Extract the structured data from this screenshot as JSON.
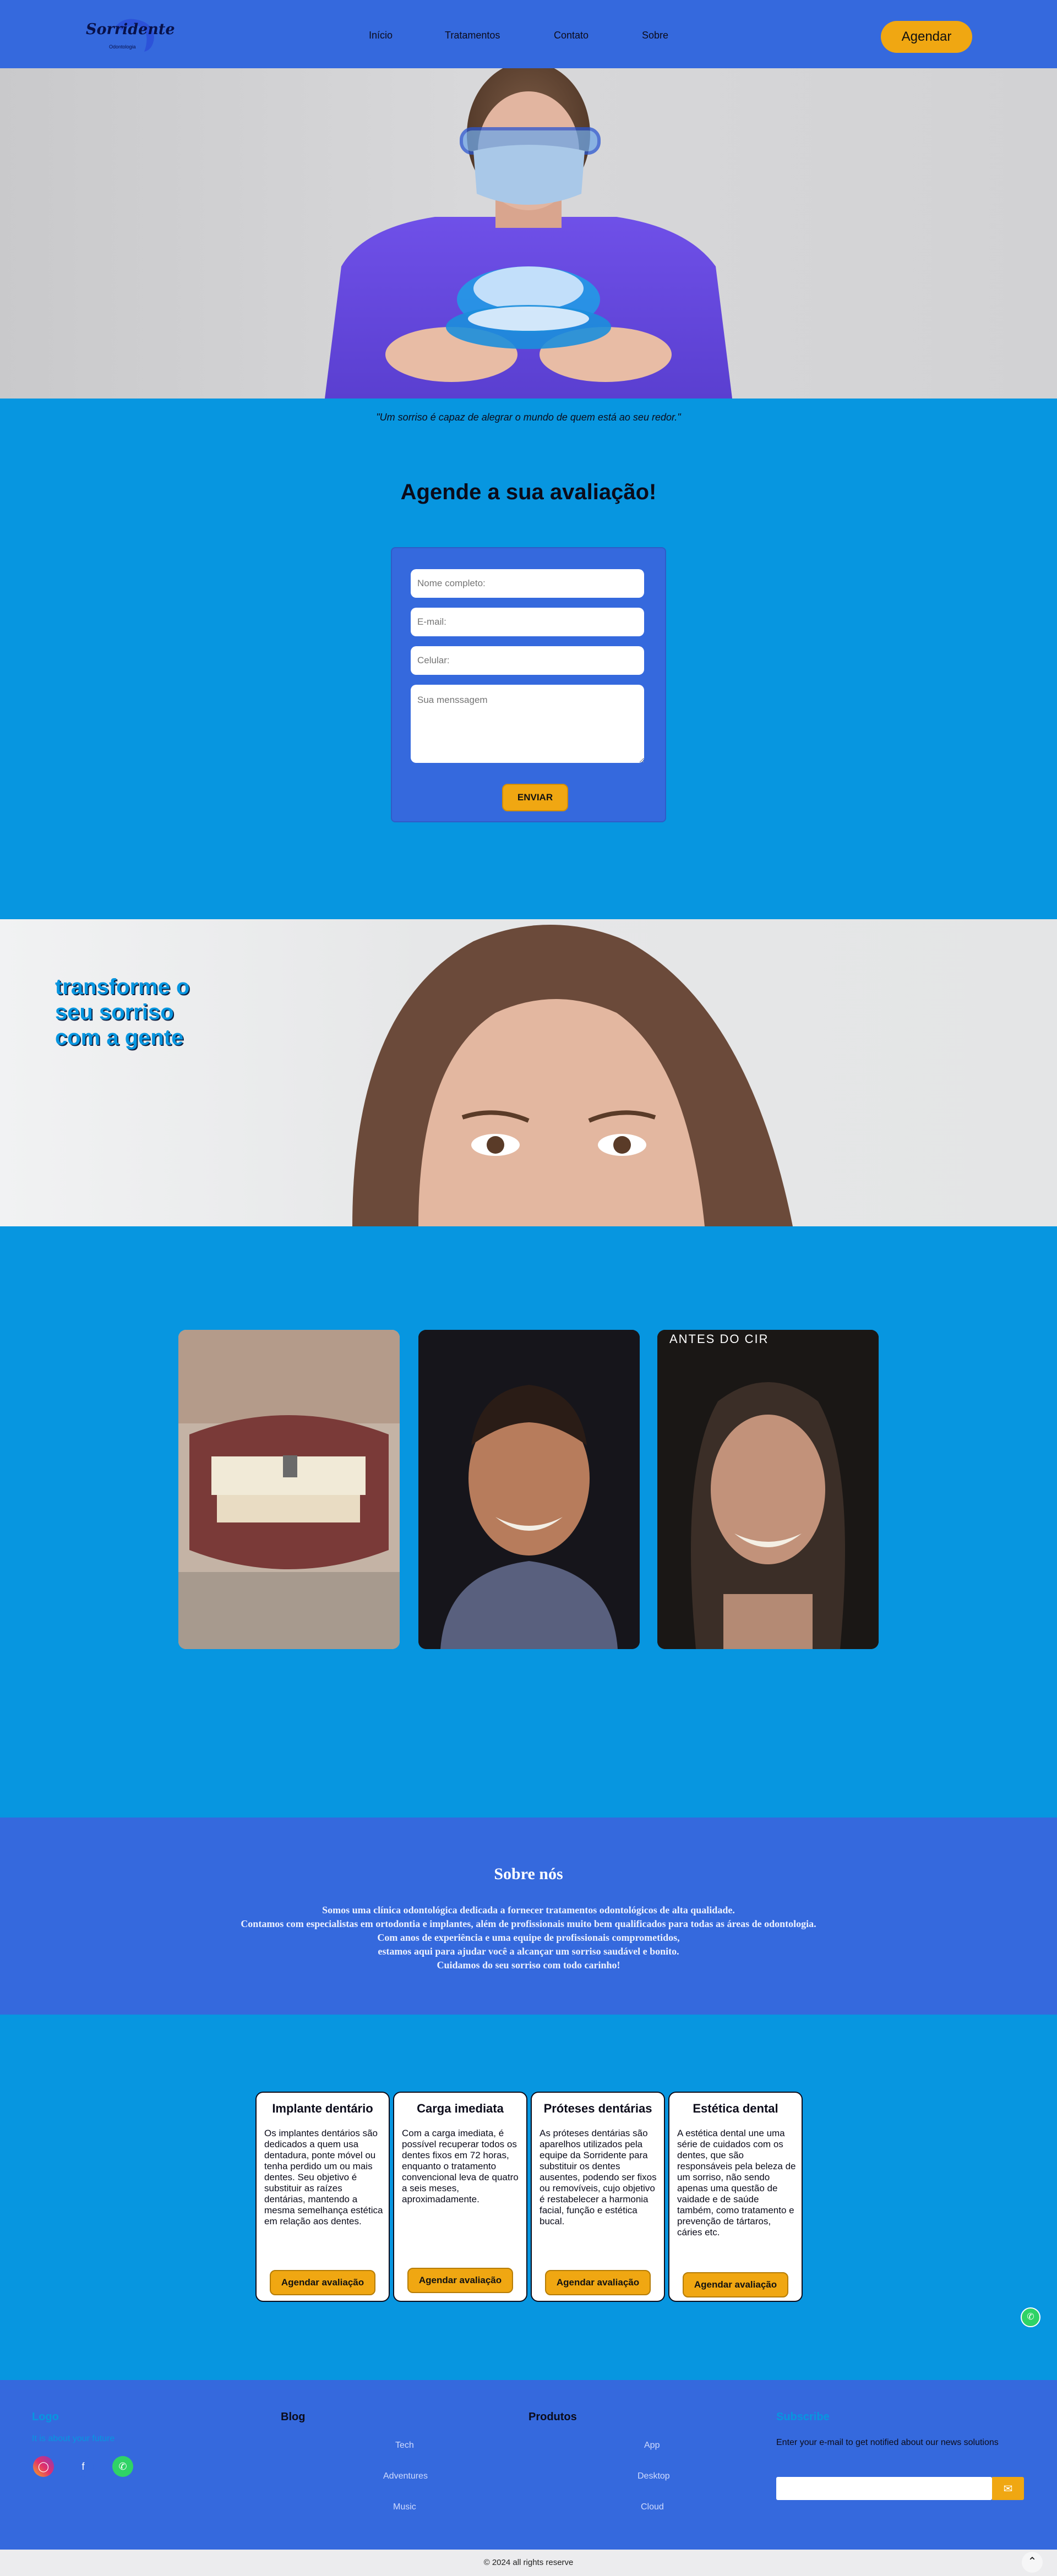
{
  "header": {
    "logo_text": "Sorridente",
    "logo_sub": "Odontologia",
    "nav": [
      "Início",
      "Tratamentos",
      "Contato",
      "Sobre"
    ],
    "cta": "Agendar"
  },
  "quote": "\"Um sorriso é capaz de alegrar o mundo de quem está ao seu redor.\"",
  "form": {
    "title": "Agende a sua avaliação!",
    "name_placeholder": "Nome completo:",
    "email_placeholder": "E-mail:",
    "phone_placeholder": "Celular:",
    "message_placeholder": "Sua menssagem",
    "submit": "ENVIAR"
  },
  "banner": {
    "lines": [
      "transforme o",
      "seu sorriso",
      "com a gente"
    ]
  },
  "gallery": {
    "overlay_label": "ANTES DO CIR"
  },
  "about": {
    "title": "Sobre nós",
    "lines": [
      "Somos uma clínica odontológica dedicada a fornecer tratamentos odontológicos de alta qualidade.",
      "Contamos com especialistas em ortodontia e implantes, além de profissionais muito bem qualificados para todas as áreas de odontologia.",
      "Com anos de experiência e uma equipe de profissionais comprometidos,",
      "estamos aqui para ajudar você a alcançar um sorriso saudável e bonito.",
      "Cuidamos do seu sorriso com todo carinho!"
    ]
  },
  "services": [
    {
      "title": "Implante dentário",
      "text": "Os implantes dentários são dedicados a quem usa dentadura, ponte móvel ou tenha perdido um ou mais dentes. Seu objetivo é substituir as raízes dentárias, mantendo a mesma semelhança estética em relação aos dentes.",
      "button": "Agendar avaliação"
    },
    {
      "title": "Carga imediata",
      "text": "Com a carga imediata, é possível recuperar todos os dentes fixos em 72 horas, enquanto o tratamento convencional leva de quatro a seis meses, aproximadamente.",
      "button": "Agendar avaliação"
    },
    {
      "title": "Próteses dentárias",
      "text": "As próteses dentárias são aparelhos utilizados pela equipe da Sorridente para substituir os dentes ausentes, podendo ser fixos ou removíveis, cujo objetivo é restabelecer a harmonia facial, função e estética bucal.",
      "button": "Agendar avaliação"
    },
    {
      "title": "Estética dental",
      "text": "A estética dental une uma série de cuidados com os dentes, que são responsáveis pela beleza de um sorriso, não sendo apenas uma questão de vaidade e de saúde também, como tratamento e prevenção de tártaros, cáries etc.",
      "button": "Agendar avaliação"
    }
  ],
  "footer": {
    "col1_title": "Logo",
    "col1_text": "It is about your future",
    "blog_title": "Blog",
    "blog_links": [
      "Tech",
      "Adventures",
      "Music"
    ],
    "products_title": "Produtos",
    "product_links": [
      "App",
      "Desktop",
      "Cloud"
    ],
    "subscribe_title": "Subscribe",
    "subscribe_text": "Enter your e-mail to get notified about our news solutions",
    "copyright": "© 2024 all rights reserve"
  },
  "colors": {
    "page_bg": "#0796e0",
    "header_bg": "#3569dd",
    "accent": "#f0a712"
  },
  "icons": [
    "instagram-icon",
    "facebook-icon",
    "whatsapp-icon",
    "envelope-icon",
    "chevron-up-icon"
  ]
}
